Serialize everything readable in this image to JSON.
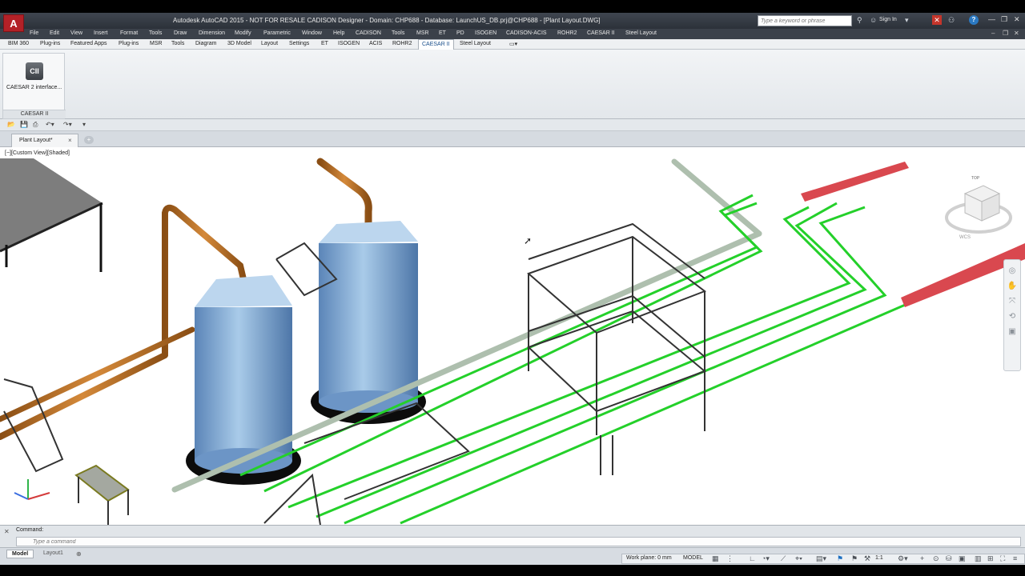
{
  "titlebar": {
    "app_logo": "A",
    "title": "Autodesk AutoCAD 2015 - NOT FOR RESALE   CADISON Designer - Domain: CHP688 - Database: LaunchUS_DB.prj@CHP688 - [Plant Layout.DWG]",
    "search_placeholder": "Type a keyword or phrase",
    "sign_in": "Sign In",
    "help": "?"
  },
  "menu": {
    "items": [
      "File",
      "Edit",
      "View",
      "Insert",
      "Format",
      "Tools",
      "Draw",
      "Dimension",
      "Modify",
      "Parametric",
      "Window",
      "Help",
      "CADISON",
      "Tools",
      "MSR",
      "ET",
      "PD",
      "ISOGEN",
      "CADISON-ACIS",
      "ROHR2",
      "CAESAR II",
      "Steel Layout"
    ]
  },
  "ribbon": {
    "tabs": [
      "BIM 360",
      "Plug-ins",
      "Featured Apps",
      "Plug-ins",
      "MSR",
      "Tools",
      "Diagram",
      "3D Model",
      "Layout",
      "Settings",
      "ET",
      "ISOGEN",
      "ACIS",
      "ROHR2",
      "CAESAR II",
      "Steel Layout"
    ],
    "active_tab": "CAESAR II",
    "panel": {
      "button_icon_text": "CII",
      "button_label": "CAESAR 2 interface...",
      "panel_title": "CAESAR II"
    }
  },
  "filetabs": {
    "active": "Plant Layout*",
    "close": "×",
    "add": "+"
  },
  "viewport": {
    "view_label": "[−][Custom View][Shaded]",
    "viewcube_label": "TOP",
    "wcs_label": "WCS",
    "colors": {
      "steel_pipe": "#c0711f",
      "tank": "#7aa6d2",
      "green_line": "#26c92b",
      "red_duct": "#d94a4f",
      "grey_pipe": "#a9b9a9",
      "structure": "#3a3a3a"
    }
  },
  "command": {
    "history": "Command:",
    "placeholder": "Type a command"
  },
  "layout_tabs": [
    "Model",
    "Layout1"
  ],
  "status": {
    "work_plane": "Work plane: 0 mm",
    "space": "MODEL",
    "scale": "1:1"
  }
}
